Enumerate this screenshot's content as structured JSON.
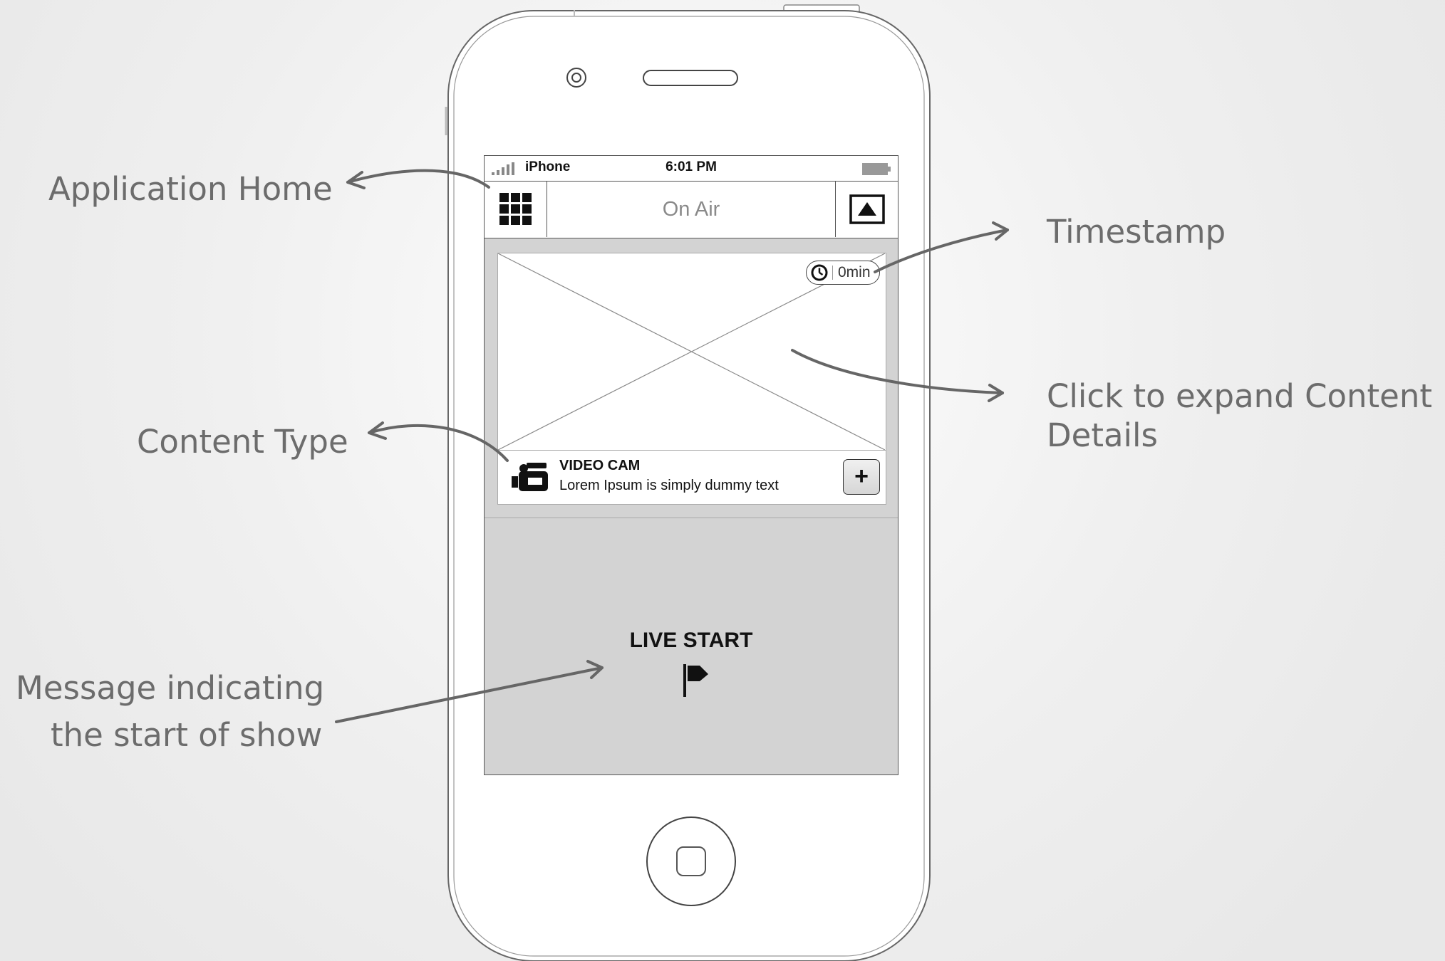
{
  "callouts": {
    "application_home": "Application Home",
    "content_type": "Content Type",
    "message_line1": "Message indicating",
    "message_line2": "the start of show",
    "timestamp": "Timestamp",
    "expand_line1": "Click to expand Content",
    "expand_line2": "Details"
  },
  "status_bar": {
    "carrier": "iPhone",
    "time": "6:01 PM"
  },
  "nav_bar": {
    "title": "On Air",
    "left_icon": "grid-icon",
    "right_icon": "airplay-icon"
  },
  "content_card": {
    "timestamp": "0min",
    "type_label": "VIDEO CAM",
    "description": "Lorem Ipsum is simply dummy text",
    "type_icon": "video-camera-icon",
    "expand_label": "+"
  },
  "live": {
    "label": "LIVE START",
    "icon": "flag-icon"
  },
  "colors": {
    "annotation_text": "#6c6c6c",
    "annotation_arrow": "#666666",
    "screen_background": "#d3d3d3"
  }
}
